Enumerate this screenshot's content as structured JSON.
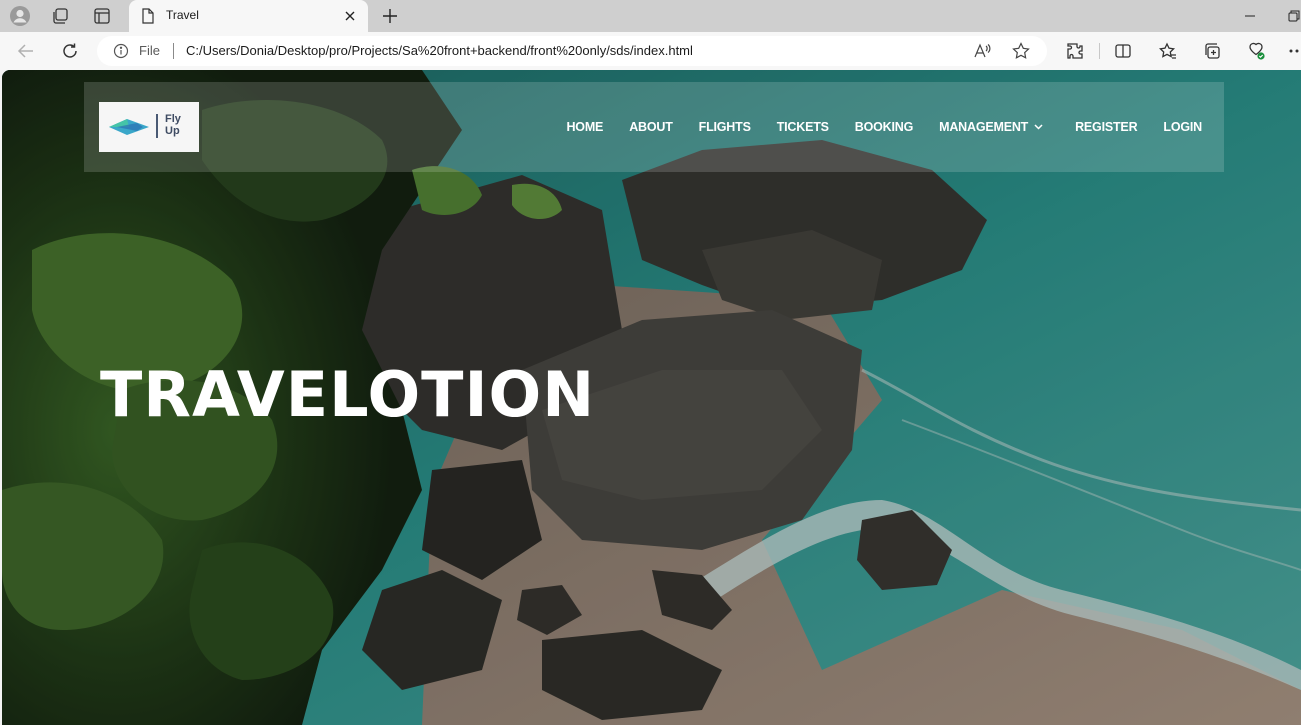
{
  "browser": {
    "tab": {
      "title": "Travel"
    },
    "address": {
      "scheme_label": "File",
      "url": "C:/Users/Donia/Desktop/pro/Projects/Sa%20front+backend/front%20only/sds/index.html"
    }
  },
  "site": {
    "logo": {
      "line1": "Fly",
      "line2": "Up"
    },
    "menu": [
      {
        "label": "HOME"
      },
      {
        "label": "ABOUT"
      },
      {
        "label": "FLIGHTS"
      },
      {
        "label": "TICKETS"
      },
      {
        "label": "BOOKING"
      },
      {
        "label": "MANAGEMENT",
        "has_dropdown": true
      },
      {
        "label": "REGISTER"
      },
      {
        "label": "LOGIN"
      }
    ],
    "hero_title": "TRAVELOTION"
  },
  "colors": {
    "tabstrip": "#cfcfcf",
    "toolbar": "#f7f7f7",
    "nav_overlay": "rgba(255,255,255,0.16)",
    "hero_text": "#ffffff"
  }
}
